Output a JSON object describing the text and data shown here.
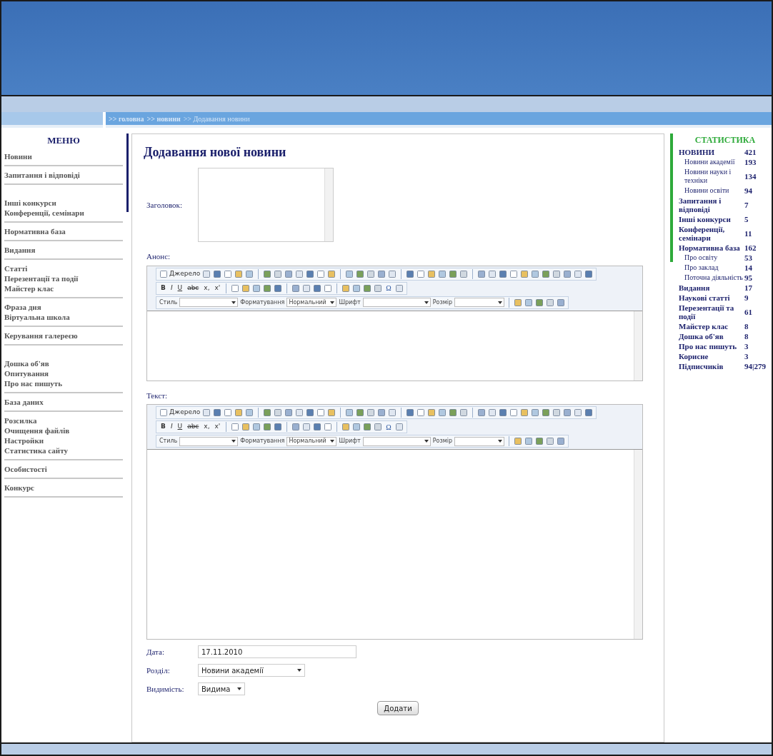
{
  "breadcrumb": [
    ">> головна",
    ">> новини",
    ">> Додавання новини"
  ],
  "menu": {
    "title": "МЕНЮ",
    "groups": [
      [
        "Новини"
      ],
      [
        "Запитання і відповіді"
      ],
      [
        "Інші конкурси",
        "Конференції, семінари"
      ],
      [
        "Нормативна база"
      ],
      [
        "Видання"
      ],
      [
        "Статті",
        "Перезентації та події",
        "Майстер клас"
      ],
      [
        "Фраза дня",
        "Віртуальна школа"
      ],
      [
        "Керування галереєю"
      ],
      [
        "Дошка об'яв",
        "Опитування",
        "Про нас пишуть"
      ],
      [
        "База даних"
      ],
      [
        "Розсилка",
        "Очищення файлів",
        "Настройки",
        "Статистика сайту"
      ],
      [
        "Особистості"
      ],
      [
        "Конкурс"
      ]
    ]
  },
  "heading": "Додавання нової новини",
  "title_field": {
    "label": "Заголовок:"
  },
  "editors": [
    {
      "label": "Анонс:",
      "source": "Джерело",
      "format_keys": [
        "B",
        "I",
        "U",
        "abc",
        "x,",
        "x'"
      ],
      "special_char": "Ω",
      "style_label": "Стиль",
      "format_label": "Форматування",
      "format_value": "Нормальний",
      "font_label": "Шрифт",
      "size_label": "Розмір"
    },
    {
      "label": "Текст:",
      "source": "Джерело",
      "format_keys": [
        "B",
        "I",
        "U",
        "abc",
        "x,",
        "x'"
      ],
      "special_char": "Ω",
      "style_label": "Стиль",
      "format_label": "Форматування",
      "format_value": "Нормальний",
      "font_label": "Шрифт",
      "size_label": "Розмір"
    }
  ],
  "date": {
    "label": "Дата:",
    "value": "17.11.2010"
  },
  "section": {
    "label": "Розділ:",
    "value": "Новини академії"
  },
  "visibility": {
    "label": "Видимість:",
    "value": "Видима"
  },
  "submit": "Додати",
  "stats": {
    "title": "СТАТИСТИКА",
    "rows": [
      {
        "kind": "main",
        "label": "НОВИНИ",
        "count": "421"
      },
      {
        "kind": "sub",
        "label": "Новини академії",
        "count": "193"
      },
      {
        "kind": "sub",
        "label": "Новини науки і техніки",
        "count": "134"
      },
      {
        "kind": "sub",
        "label": "Новини освіти",
        "count": "94"
      },
      {
        "kind": "main",
        "label": "Запитання і відповіді",
        "count": "7"
      },
      {
        "kind": "main",
        "label": "Інші конкурси",
        "count": "5"
      },
      {
        "kind": "main",
        "label": "Конференції, семінари",
        "count": "11"
      },
      {
        "kind": "main",
        "label": "Нормативна база",
        "count": "162"
      },
      {
        "kind": "sub",
        "label": "Про освіту",
        "count": "53"
      },
      {
        "kind": "sub",
        "label": "Про заклад",
        "count": "14"
      },
      {
        "kind": "sub",
        "label": "Поточна діяльність",
        "count": "95"
      },
      {
        "kind": "main",
        "label": "Видання",
        "count": "17"
      },
      {
        "kind": "main",
        "label": "Наукові статті",
        "count": "9"
      },
      {
        "kind": "main",
        "label": "Перезентації та події",
        "count": "61"
      },
      {
        "kind": "main",
        "label": "Майстер клас",
        "count": "8"
      },
      {
        "kind": "main",
        "label": "Дошка об'яв",
        "count": "8"
      },
      {
        "kind": "main",
        "label": "Про нас пишуть",
        "count": "3"
      },
      {
        "kind": "main",
        "label": "Корисне",
        "count": "3"
      },
      {
        "kind": "main",
        "label": "Підписчиків",
        "count": "94|279"
      }
    ]
  }
}
